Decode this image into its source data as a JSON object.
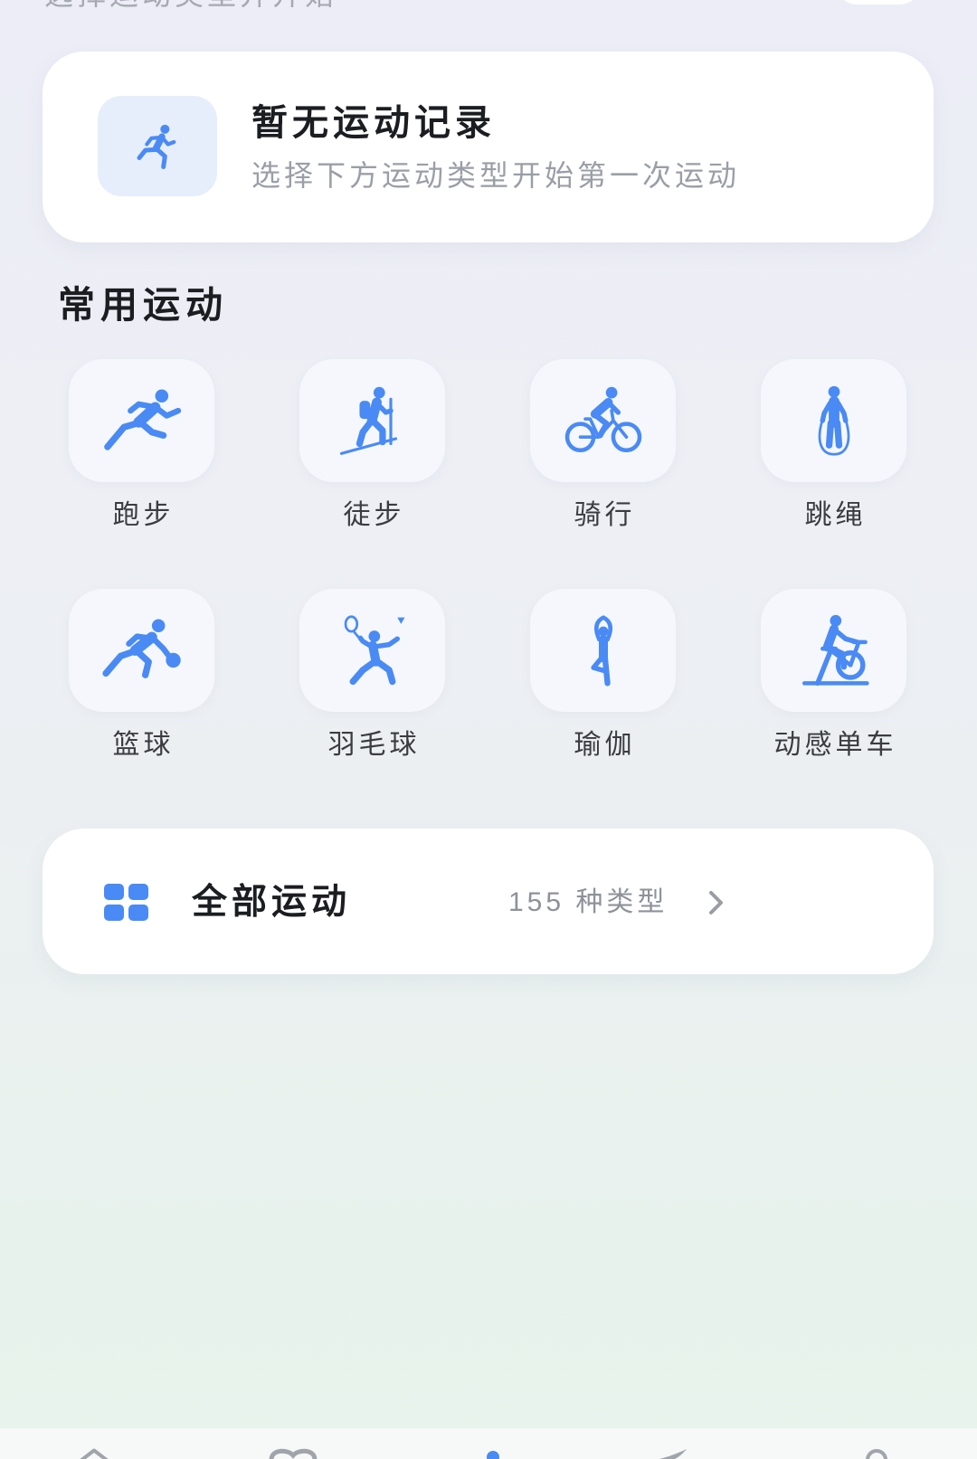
{
  "page": {
    "top_hint": "选择运动类型并开始"
  },
  "empty_record": {
    "icon": "running-icon",
    "title": "暂无运动记录",
    "subtitle": "选择下方运动类型开始第一次运动"
  },
  "common_sports": {
    "heading": "常用运动",
    "items": [
      {
        "label": "跑步",
        "icon": "running-icon"
      },
      {
        "label": "徒步",
        "icon": "hiking-icon"
      },
      {
        "label": "骑行",
        "icon": "cycling-icon"
      },
      {
        "label": "跳绳",
        "icon": "jump-rope-icon"
      },
      {
        "label": "篮球",
        "icon": "basketball-icon"
      },
      {
        "label": "羽毛球",
        "icon": "badminton-icon"
      },
      {
        "label": "瑜伽",
        "icon": "yoga-icon"
      },
      {
        "label": "动感单车",
        "icon": "spin-bike-icon"
      }
    ]
  },
  "all_sports": {
    "icon": "grid-icon",
    "label": "全部运动",
    "count": "155 种类型",
    "chevron": "chevron-right-icon"
  },
  "bottom_nav": {
    "items": [
      {
        "icon": "home-icon",
        "active": false
      },
      {
        "icon": "health-icon",
        "active": false
      },
      {
        "icon": "workout-icon",
        "active": true
      },
      {
        "icon": "discover-icon",
        "active": false
      },
      {
        "icon": "profile-icon",
        "active": false
      }
    ]
  },
  "colors": {
    "accent": "#4a8af4",
    "card": "#ffffff",
    "title": "#1c1d21",
    "secondary_text": "#9a9ea6",
    "icon_tile": "#f5f7fd",
    "record_icon_bg": "#e6eefc",
    "nav_inactive": "#a0a4ab"
  }
}
